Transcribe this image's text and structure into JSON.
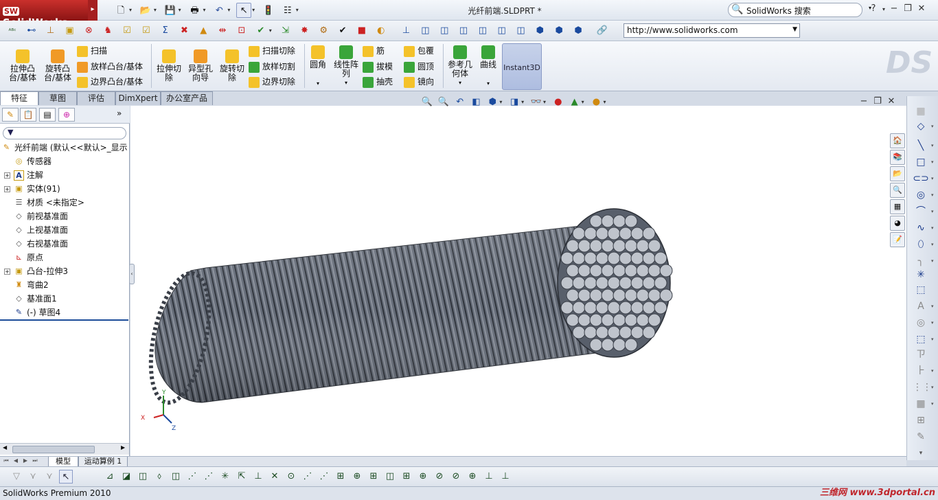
{
  "titlebar": {
    "app_logo": "SolidWorks",
    "doc_title": "光纤前端.SLDPRT *",
    "search_label": "SolidWorks 搜索",
    "help": "?"
  },
  "toolbar2": {
    "url": "http://www.solidworks.com"
  },
  "cmd": {
    "extrude_boss": "拉伸凸台/基体",
    "revolve_boss": "旋转凸台/基体",
    "sweep": "扫描",
    "loft_boss": "放样凸台/基体",
    "boundary_boss": "边界凸台/基体",
    "extrude_cut": "拉伸切除",
    "hole_wizard": "异型孔向导",
    "revolve_cut": "旋转切除",
    "sweep_cut": "扫描切除",
    "loft_cut": "放样切割",
    "boundary_cut": "边界切除",
    "fillet": "圆角",
    "linear_pattern": "线性阵列",
    "rib": "筋",
    "draft": "拔模",
    "shell": "抽壳",
    "wrap": "包覆",
    "dome": "圆顶",
    "mirror": "镜向",
    "ref_geometry": "参考几何体",
    "curves": "曲线",
    "instant3d": "Instant3D"
  },
  "cmd_tabs": [
    "特征",
    "草图",
    "评估",
    "DimXpert",
    "办公室产品"
  ],
  "tree": {
    "root": "光纤前端 (默认<<默认>_显示",
    "items": [
      {
        "label": "传感器",
        "expand": false
      },
      {
        "label": "注解",
        "expand": true
      },
      {
        "label": "实体(91)",
        "expand": true
      },
      {
        "label": "材质 <未指定>",
        "expand": false
      },
      {
        "label": "前视基准面",
        "expand": false
      },
      {
        "label": "上视基准面",
        "expand": false
      },
      {
        "label": "右视基准面",
        "expand": false
      },
      {
        "label": "原点",
        "expand": false
      },
      {
        "label": "凸台-拉伸3",
        "expand": true
      },
      {
        "label": "弯曲2",
        "expand": false
      },
      {
        "label": "基准面1",
        "expand": false
      },
      {
        "label": "(-) 草图4",
        "expand": false
      }
    ]
  },
  "triad": {
    "x": "X",
    "y": "Y",
    "z": "Z"
  },
  "bottom_tabs": [
    "模型",
    "运动算例 1"
  ],
  "status": "SolidWorks Premium 2010",
  "watermark": "三维网 www.3dportal.cn",
  "colors": {
    "titlebar": "#e4eaf2",
    "logo_red": "#b21b1b",
    "model_gray": "#5f6672",
    "accent_blue": "#1c4d99"
  }
}
